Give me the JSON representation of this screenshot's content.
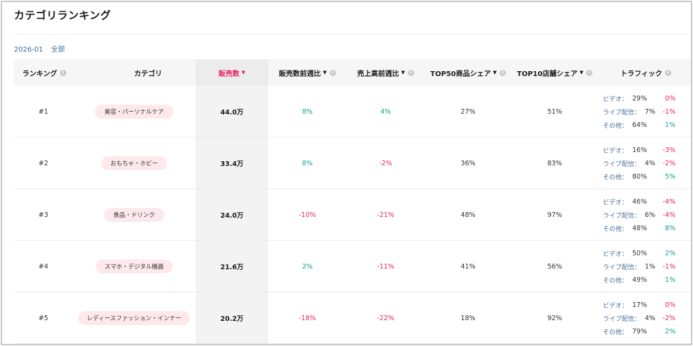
{
  "page": {
    "title": "カテゴリランキング"
  },
  "filter": {
    "period": "2026-01",
    "scope": "全部"
  },
  "table": {
    "columns": [
      {
        "label": "ランキング",
        "info": true,
        "caret": false
      },
      {
        "label": "カテゴリ",
        "info": false,
        "caret": false
      },
      {
        "label": "販売数",
        "info": false,
        "caret": true
      },
      {
        "label": "販売数前週比",
        "info": true,
        "caret": true
      },
      {
        "label": "売上高前週比",
        "info": true,
        "caret": true
      },
      {
        "label": "TOP50商品シェア",
        "info": true,
        "caret": true
      },
      {
        "label": "TOP10店舗シェア",
        "info": true,
        "caret": true
      },
      {
        "label": "トラフィック",
        "info": true,
        "caret": false
      }
    ],
    "traffic_labels": [
      "ビデオ：",
      "ライブ配信：",
      "その他："
    ],
    "rows": [
      {
        "rank": "#1",
        "category": "美容・パーソナルケア",
        "sold": "44.0万",
        "sold_wow": "8%",
        "revenue_wow": "4%",
        "top50": "27%",
        "top10": "51%",
        "traffic": [
          {
            "value": "29%",
            "change": "0%"
          },
          {
            "value": "7%",
            "change": "-1%"
          },
          {
            "value": "64%",
            "change": "1%"
          }
        ]
      },
      {
        "rank": "#2",
        "category": "おもちゃ・ホビー",
        "sold": "33.4万",
        "sold_wow": "8%",
        "revenue_wow": "-2%",
        "top50": "36%",
        "top10": "83%",
        "traffic": [
          {
            "value": "16%",
            "change": "-3%"
          },
          {
            "value": "4%",
            "change": "-2%"
          },
          {
            "value": "80%",
            "change": "5%"
          }
        ]
      },
      {
        "rank": "#3",
        "category": "食品・ドリンク",
        "sold": "24.0万",
        "sold_wow": "-10%",
        "revenue_wow": "-21%",
        "top50": "48%",
        "top10": "97%",
        "traffic": [
          {
            "value": "46%",
            "change": "-4%"
          },
          {
            "value": "6%",
            "change": "-4%"
          },
          {
            "value": "48%",
            "change": "8%"
          }
        ]
      },
      {
        "rank": "#4",
        "category": "スマホ・デジタル機器",
        "sold": "21.6万",
        "sold_wow": "2%",
        "revenue_wow": "-11%",
        "top50": "41%",
        "top10": "56%",
        "traffic": [
          {
            "value": "50%",
            "change": "2%"
          },
          {
            "value": "1%",
            "change": "-1%"
          },
          {
            "value": "49%",
            "change": "1%"
          }
        ]
      },
      {
        "rank": "#5",
        "category": "レディースファッション・インナー",
        "sold": "20.2万",
        "sold_wow": "-18%",
        "revenue_wow": "-22%",
        "top50": "18%",
        "top10": "92%",
        "traffic": [
          {
            "value": "17%",
            "change": "0%"
          },
          {
            "value": "4%",
            "change": "-2%"
          },
          {
            "value": "79%",
            "change": "2%"
          }
        ]
      }
    ]
  },
  "colors": {
    "accent": "#e8265e",
    "positive": "#13a38f",
    "pill_bg": "#fde9ec",
    "link": "#3d6a9e"
  }
}
